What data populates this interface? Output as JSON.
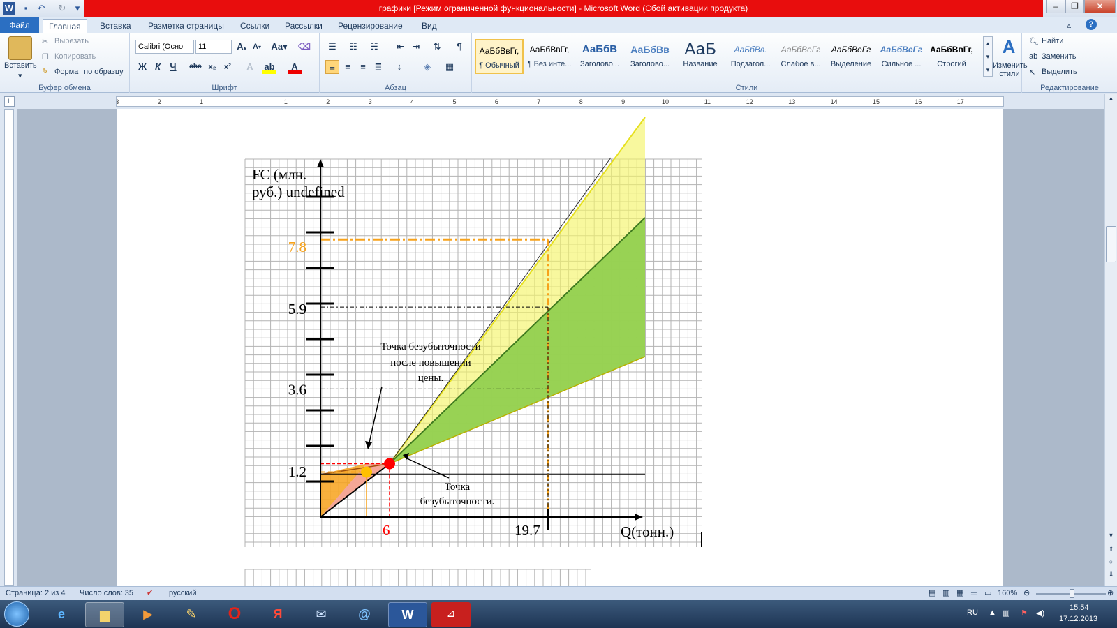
{
  "window": {
    "title": "графики [Режим ограниченной функциональности] - Microsoft Word (Сбой активации продукта)"
  },
  "tabs": {
    "file": "Файл",
    "items": [
      "Главная",
      "Вставка",
      "Разметка страницы",
      "Ссылки",
      "Рассылки",
      "Рецензирование",
      "Вид"
    ]
  },
  "clipboard": {
    "paste": "Вставить",
    "cut": "Вырезать",
    "copy": "Копировать",
    "format_painter": "Формат по образцу",
    "label": "Буфер обмена"
  },
  "font": {
    "name": "Calibri (Осно",
    "size": "11",
    "label": "Шрифт"
  },
  "paragraph": {
    "label": "Абзац"
  },
  "styles": {
    "label": "Стили",
    "change": "Изменить стили",
    "tiles": [
      {
        "sample": "АаБбВвГг,",
        "name": "¶ Обычный"
      },
      {
        "sample": "АаБбВвГг,",
        "name": "¶ Без инте..."
      },
      {
        "sample": "АаБбВ",
        "name": "Заголово..."
      },
      {
        "sample": "АаБбВв",
        "name": "Заголово..."
      },
      {
        "sample": "АаБ",
        "name": "Название"
      },
      {
        "sample": "АаБбВв.",
        "name": "Подзагол..."
      },
      {
        "sample": "АаБбВеГг",
        "name": "Слабое в..."
      },
      {
        "sample": "АаБбВеГг",
        "name": "Выделение"
      },
      {
        "sample": "АаБбВеГг",
        "name": "Сильное ..."
      },
      {
        "sample": "АаБбВвГг,",
        "name": "Строгий"
      }
    ]
  },
  "editing": {
    "find": "Найти",
    "replace": "Заменить",
    "select": "Выделить",
    "label": "Редактирование"
  },
  "status": {
    "page": "Страница: 2 из 4",
    "words": "Число слов: 35",
    "lang": "русский",
    "zoom": "160%"
  },
  "tray": {
    "lang": "RU",
    "time": "15:54",
    "date": "17.12.2013"
  },
  "chart_data": {
    "type": "line",
    "ylabel": "FC (млн. руб.)",
    "xlabel": "Q(тонн.)",
    "y_ticks": [
      "7.8",
      "5.9",
      "3.6",
      "1.2"
    ],
    "x_ticks": [
      "6",
      "19.7"
    ],
    "annotations": [
      "Точка безубыточности после повышении цены.",
      "Точка безубыточности."
    ],
    "colors": {
      "yellow": "#f4f46a",
      "green": "#92d050",
      "orange": "#f7a21b",
      "red": "#ff0000",
      "pink": "#f4a6a0"
    },
    "series": [
      {
        "x": [
          0,
          6,
          19.7
        ],
        "y": [
          0,
          1.5,
          7.8
        ]
      },
      {
        "x": [
          0,
          6,
          19.7
        ],
        "y": [
          1.2,
          1.5,
          5.9
        ]
      },
      {
        "x": [
          0,
          6,
          19.7
        ],
        "y": [
          1.2,
          1.5,
          3.6
        ]
      }
    ],
    "points": [
      {
        "x": 4,
        "y": 1.5
      },
      {
        "x": 6,
        "y": 1.5
      }
    ]
  }
}
